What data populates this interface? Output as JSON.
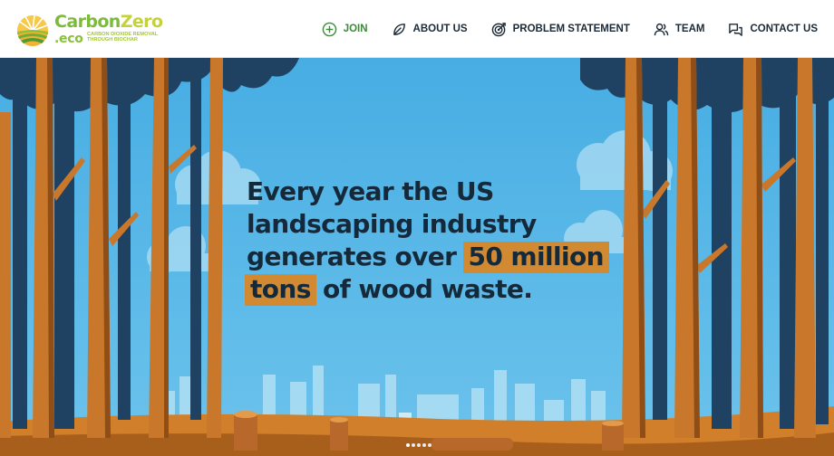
{
  "brand": {
    "name_part1": "Carbon",
    "name_part2": "Zero",
    "suffix": ".eco",
    "tagline": "Carbon dioxide removal through biochar"
  },
  "nav": {
    "items": [
      {
        "label": "JOIN",
        "icon": "plus-circle-icon"
      },
      {
        "label": "ABOUT US",
        "icon": "leaf-icon"
      },
      {
        "label": "PROBLEM STATEMENT",
        "icon": "target-icon"
      },
      {
        "label": "TEAM",
        "icon": "users-icon"
      },
      {
        "label": "CONTACT US",
        "icon": "chat-icon"
      }
    ]
  },
  "hero": {
    "line1": "Every year the US",
    "line2": "landscaping industry",
    "line3_pre": "generates over",
    "line3_highlight": "50 million",
    "line4_highlight": "tons",
    "line4_post": "of wood waste.",
    "highlight_color": "#d28a32",
    "sky_color": "#4fb3e6",
    "slide_count": 5,
    "active_slide": 1
  }
}
